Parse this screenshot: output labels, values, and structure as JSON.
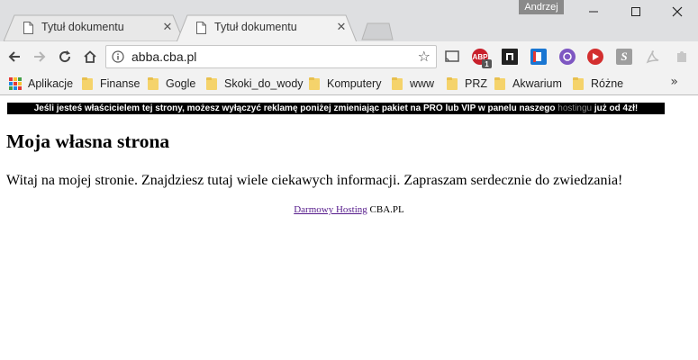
{
  "window": {
    "user": "Andrzej"
  },
  "tabs": [
    {
      "title": "Tytuł dokumentu",
      "active": false
    },
    {
      "title": "Tytuł dokumentu",
      "active": true
    }
  ],
  "omnibox": {
    "url": "abba.cba.pl"
  },
  "extensions": [
    "cast-icon",
    "adblock-icon",
    "bookmark-ext-icon",
    "pocket-icon",
    "circle-ext-icon",
    "play-ext-icon",
    "s-ext-icon",
    "pdf-ext-icon",
    "puzzle-ext-icon"
  ],
  "adblock_badge": "1",
  "bookmarks": [
    {
      "label": "Aplikacje",
      "icon": "apps-icon"
    },
    {
      "label": "Finanse",
      "icon": "folder-icon"
    },
    {
      "label": "Gogle",
      "icon": "folder-icon"
    },
    {
      "label": "Skoki_do_wody",
      "icon": "folder-icon"
    },
    {
      "label": "Komputery",
      "icon": "folder-icon"
    },
    {
      "label": "www",
      "icon": "folder-icon"
    },
    {
      "label": "PRZ",
      "icon": "folder-icon"
    },
    {
      "label": "Akwarium",
      "icon": "folder-icon"
    },
    {
      "label": "Różne",
      "icon": "folder-icon"
    }
  ],
  "bookmarks_more": "»",
  "page": {
    "ad_text_pre": "Jeśli jesteś właścicielem tej strony, możesz wyłączyć reklamę poniżej zmieniając pakiet na PRO lub VIP w panelu naszego",
    "ad_link": "hostingu",
    "ad_text_post": "już od 4zł!",
    "heading": "Moja własna strona",
    "paragraph": "Witaj na mojej stronie. Znajdziesz tutaj wiele ciekawych informacji. Zapraszam serdecznie do zwiedzania!",
    "footer_link": "Darmowy Hosting",
    "footer_text": "CBA.PL"
  }
}
